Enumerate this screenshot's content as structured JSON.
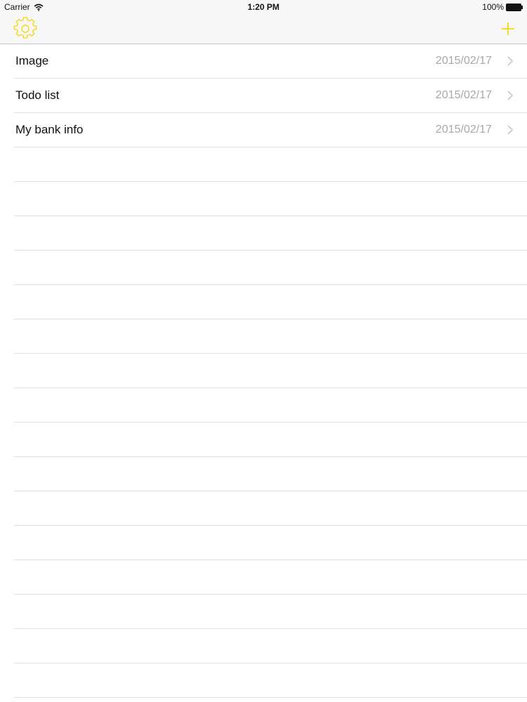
{
  "status_bar": {
    "carrier": "Carrier",
    "time": "1:20 PM",
    "battery": "100%",
    "icons": [
      "wifi-icon",
      "battery-icon"
    ]
  },
  "nav_bar": {
    "left_icon": "gear-icon",
    "right_icon": "plus-icon",
    "accent_color": "#f5d80f"
  },
  "notes": [
    {
      "title": "Image",
      "date": "2015/02/17"
    },
    {
      "title": "Todo list",
      "date": "2015/02/17"
    },
    {
      "title": "My bank info",
      "date": "2015/02/17"
    }
  ],
  "colors": {
    "date_text": "#a8a8ad",
    "separator": "#e0e0e0",
    "chevron": "#c7c7cc"
  }
}
